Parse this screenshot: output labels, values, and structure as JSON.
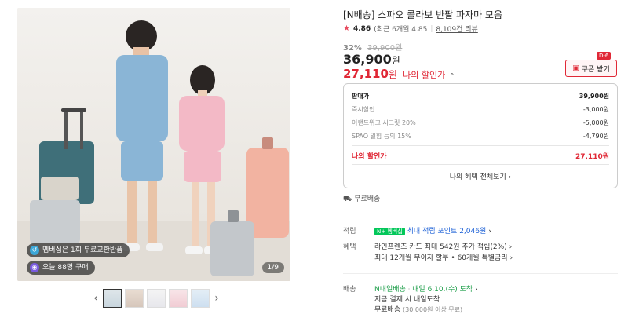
{
  "gallery": {
    "badges": [
      {
        "icon": "membership-icon",
        "text": "멤버십은 1회 무료교환반품"
      },
      {
        "icon": "purchase-count-icon",
        "text": "오늘 88명 구매"
      }
    ],
    "counter": "1/9",
    "thumb_count": 5
  },
  "product": {
    "title": "[N배송] 스파오 콜라보 반팔 파자마 모음",
    "rating": "4.86",
    "rating_recent": "(최근 6개월 4.85",
    "review_count": "8,109건 리뷰",
    "discount_pct": "32%",
    "original_price": "39,900원",
    "price": "36,900",
    "price_unit": "원",
    "my_price": "27,110",
    "my_price_unit": "원",
    "my_price_label": "나의 할인가",
    "my_price_chevron": "⌃"
  },
  "coupon": {
    "label": "쿠폰 받기",
    "badge": "D-6"
  },
  "breakdown": {
    "rows": [
      {
        "label": "판매가",
        "value": "39,900원"
      },
      {
        "label": "즉시할인",
        "value": "-3,000원"
      },
      {
        "label": "이랜드위크 시크릿 20%",
        "value": "-5,000원"
      },
      {
        "label": "SPAO 일힘 등의 15%",
        "value": "-4,790원"
      }
    ],
    "my_label": "나의 할인가",
    "my_value": "27,110원",
    "all_benefits": "나의 혜택 전체보기"
  },
  "delivery_note": "무료배송",
  "points": {
    "label": "적립",
    "badge": "N+ 멤버십",
    "text": "최대 적립 포인트 2,046원"
  },
  "benefits": {
    "label": "혜택",
    "line1": "라인프렌즈 카드 최대 542원 추가 적립(2%)",
    "line2": "최대 12개월 무이자 할부 • 60개월 특별금리"
  },
  "shipping": {
    "label": "배송",
    "badge_text": "N내일배송",
    "eta": "내일 6.10.(수) 도착",
    "line2": "지금 결제 시 내일도착",
    "line3": "무료배송",
    "line3_note": "(30,000원 이상 무료)"
  },
  "colors": {
    "accent": "#e02836",
    "blue": "#1a5fd6",
    "green": "#1e9e4a"
  }
}
